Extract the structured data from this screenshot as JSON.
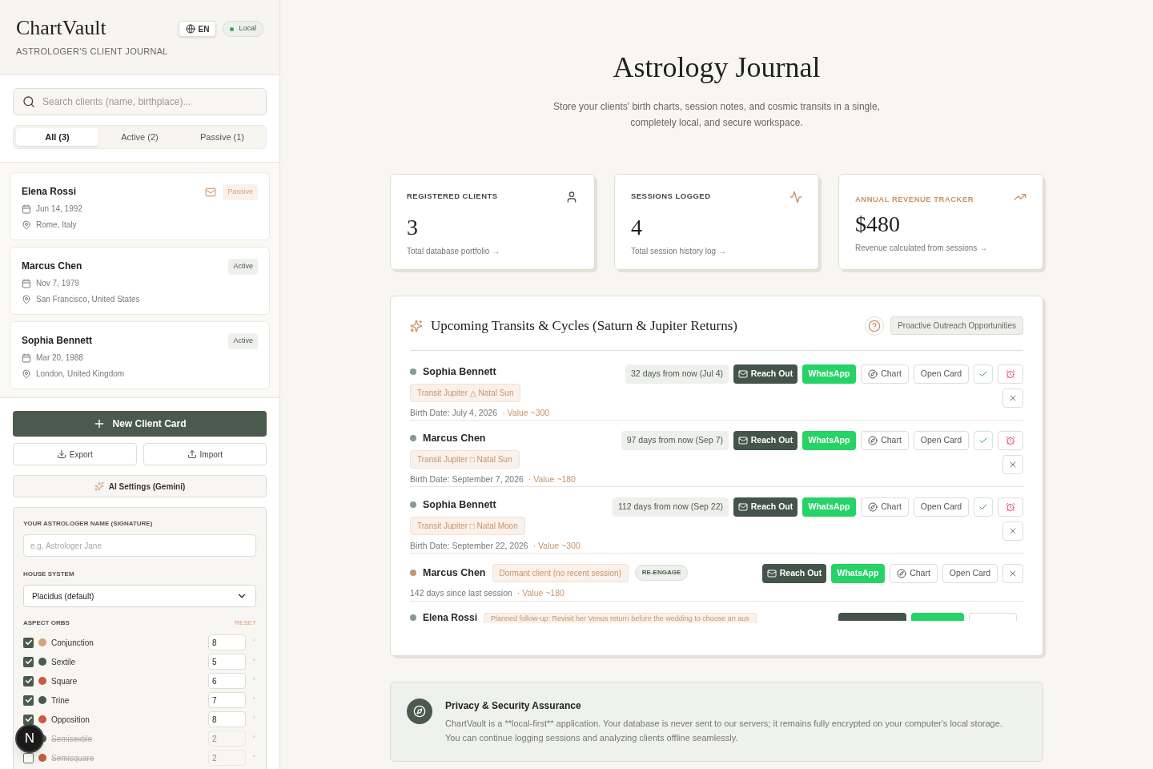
{
  "brand": {
    "title": "ChartVault",
    "subtitle": "ASTROLOGER'S CLIENT JOURNAL",
    "language": "EN",
    "storage": "Local"
  },
  "search": {
    "placeholder": "Search clients (name, birthplace)..."
  },
  "filters": [
    {
      "label": "All (3)",
      "selected": true
    },
    {
      "label": "Active (2)",
      "selected": false
    },
    {
      "label": "Passive (1)",
      "selected": false
    }
  ],
  "clients": [
    {
      "name": "Elena Rossi",
      "date": "Jun 14, 1992",
      "place": "Rome, Italy",
      "status": "Passive",
      "kind": "passive",
      "mail_flag": true
    },
    {
      "name": "Marcus Chen",
      "date": "Nov 7, 1979",
      "place": "San Francisco, United States",
      "status": "Active",
      "kind": "active",
      "mail_flag": false
    },
    {
      "name": "Sophia Bennett",
      "date": "Mar 20, 1988",
      "place": "London, United Kingdom",
      "status": "Active",
      "kind": "active",
      "mail_flag": false
    }
  ],
  "actions": {
    "new_client": "New Client Card",
    "export": "Export",
    "import": "Import",
    "ai_settings": "AI Settings (Gemini)"
  },
  "settings": {
    "name_label": "YOUR ASTROLOGER NAME (SIGNATURE)",
    "name_placeholder": "e.g. Astrologer Jane",
    "house_label": "HOUSE SYSTEM",
    "house_value": "Placidus (default)",
    "orbs_label": "ASPECT ORBS",
    "reset": "RESET",
    "orbs": [
      {
        "name": "Conjunction",
        "checked": true,
        "color": "#d4a27f",
        "value": "8",
        "unit": "°"
      },
      {
        "name": "Sextile",
        "checked": true,
        "color": "#4a5a4c",
        "value": "5",
        "unit": "°"
      },
      {
        "name": "Square",
        "checked": true,
        "color": "#c85a40",
        "value": "6",
        "unit": "°"
      },
      {
        "name": "Trine",
        "checked": true,
        "color": "#4a5a4c",
        "value": "7",
        "unit": "°"
      },
      {
        "name": "Opposition",
        "checked": true,
        "color": "#c85a40",
        "value": "8",
        "unit": "°"
      },
      {
        "name": "Semisextile",
        "checked": false,
        "color": "#4a5a4c",
        "value": "2",
        "unit": "°"
      },
      {
        "name": "Semisquare",
        "checked": false,
        "color": "#c85a40",
        "value": "2",
        "unit": "°"
      }
    ]
  },
  "dev_badge": "N",
  "main": {
    "title": "Astrology Journal",
    "intro": "Store your clients' birth charts, session notes, and cosmic transits in a single, completely local, and secure workspace."
  },
  "stats": [
    {
      "kind": "clients",
      "label": "REGISTERED CLIENTS",
      "value": "3",
      "caption": "Total database portfolio →",
      "highlight": false
    },
    {
      "kind": "sessions",
      "label": "SESSIONS LOGGED",
      "value": "4",
      "caption": "Total session history log →",
      "highlight": false
    },
    {
      "kind": "revenue",
      "label": "ANNUAL REVENUE TRACKER",
      "value": "$480",
      "caption": "Revenue calculated from sessions →",
      "highlight": true
    }
  ],
  "transits": {
    "title": "Upcoming Transits & Cycles (Saturn & Jupiter Returns)",
    "badge": "Proactive Outreach Opportunities",
    "items": [
      {
        "kind": "transit",
        "name": "Sophia Bennett",
        "color": "#8a9a8c",
        "tag": "Transit Jupiter △ Natal Sun",
        "detail": "Birth Date: July 4, 2026",
        "value": "· Value ~300",
        "when": "32 days from now (Jul 4)",
        "reach": "Reach Out",
        "whatsapp": "WhatsApp",
        "chart": "Chart",
        "open": "Open Card"
      },
      {
        "kind": "transit",
        "name": "Marcus Chen",
        "color": "#8a9a8c",
        "tag": "Transit Jupiter □ Natal Sun",
        "detail": "Birth Date: September 7, 2026",
        "value": "· Value ~180",
        "when": "97 days from now (Sep 7)",
        "reach": "Reach Out",
        "whatsapp": "WhatsApp",
        "chart": "Chart",
        "open": "Open Card"
      },
      {
        "kind": "transit",
        "name": "Sophia Bennett",
        "color": "#8a9a8c",
        "tag": "Transit Jupiter □ Natal Moon",
        "detail": "Birth Date: September 22, 2026",
        "value": "· Value ~300",
        "when": "112 days from now (Sep 22)",
        "reach": "Reach Out",
        "whatsapp": "WhatsApp",
        "chart": "Chart",
        "open": "Open Card"
      },
      {
        "kind": "dormant",
        "name": "Marcus Chen",
        "color": "#c8946a",
        "tag": "Dormant client (no recent session)",
        "badge": "RE-ENGAGE",
        "detail": "142 days since last session",
        "value": "· Value ~180",
        "reach": "Reach Out",
        "whatsapp": "WhatsApp",
        "chart": "Chart",
        "open": "Open Card"
      },
      {
        "kind": "followup",
        "name": "Elena Rossi",
        "color": "#8a9a8c",
        "tag": "Planned follow-up: Revisit her Venus return before the wedding to choose an aus"
      }
    ]
  },
  "privacy": {
    "title": "Privacy & Security Assurance",
    "body": "ChartVault is a **local-first** application. Your database is never sent to our servers; it remains fully encrypted on your computer's local storage. You can continue logging sessions and analyzing clients offline seamlessly."
  }
}
